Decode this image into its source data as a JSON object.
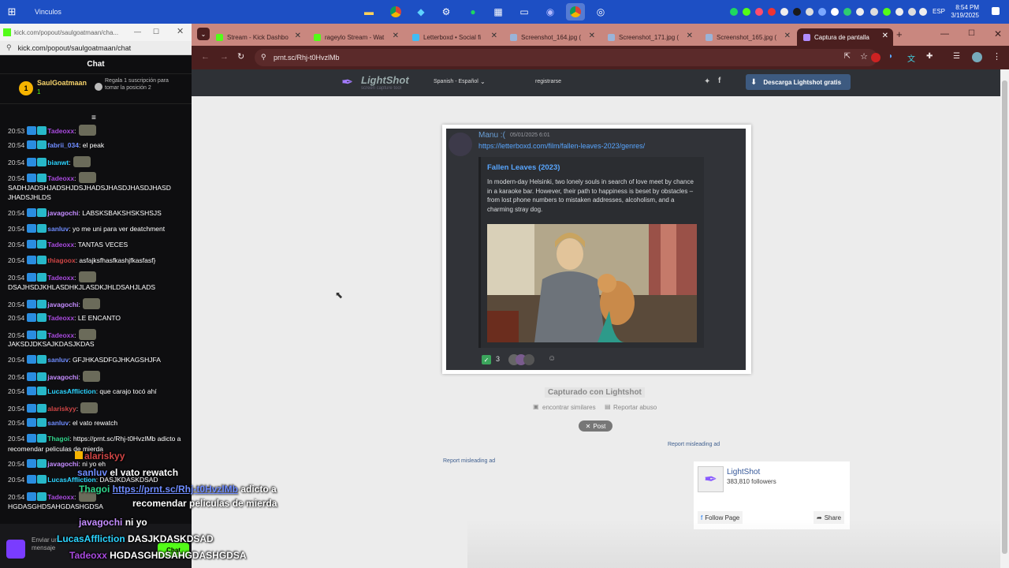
{
  "taskbar": {
    "folder": "Vinculos",
    "lang": "ESP",
    "time": "8:54 PM",
    "date": "3/19/2025"
  },
  "popout": {
    "title_url": "kick.com/popout/saulgoatmaan/cha...",
    "url": "kick.com/popout/saulgoatmaan/chat",
    "chat_header": "Chat",
    "gifter_name": "SaulGoatmaan",
    "gifter_count": "1",
    "gift_text": "Regala 1 suscripción para tomar la posición 2",
    "gift_position": "2",
    "messages": [
      {
        "time": "20:53",
        "user": "Tadeoxx",
        "color": "#a94adf",
        "text": ":"
      },
      {
        "time": "20:54",
        "user": "fabrii_034",
        "color": "#6f8cff",
        "text": ": el peak"
      },
      {
        "time": "20:54",
        "user": "bianwt",
        "color": "#2bd4ff",
        "text": ":"
      },
      {
        "time": "20:54",
        "user": "Tadeoxx",
        "color": "#a94adf",
        "text": ":"
      },
      {
        "time": "",
        "user": "",
        "color": "#ffffff",
        "text": "SADHJADSHJADSHJDSJHADSJHASDJHASDJHASD"
      },
      {
        "time": "",
        "user": "",
        "color": "#ffffff",
        "text": "JHADSJHLDS"
      },
      {
        "time": "20:54",
        "user": "javagochi",
        "color": "#c48cff",
        "text": ": LABSKSBAKSHSKSHSJS"
      },
      {
        "time": "20:54",
        "user": "sanluv",
        "color": "#6f8cff",
        "text": ": yo me uni para ver deatchment"
      },
      {
        "time": "20:54",
        "user": "Tadeoxx",
        "color": "#a94adf",
        "text": ": TANTAS VECES"
      },
      {
        "time": "20:54",
        "user": "thiagoox",
        "color": "#d04545",
        "text": ": asfajksfhasfkashjfkasfasf}"
      },
      {
        "time": "20:54",
        "user": "Tadeoxx",
        "color": "#a94adf",
        "text": ":"
      },
      {
        "time": "",
        "user": "",
        "color": "#ffffff",
        "text": "DSAJHSDJKHLASDHKJLASDKJHLDSAHJLADS"
      },
      {
        "time": "20:54",
        "user": "javagochi",
        "color": "#c48cff",
        "text": ":"
      },
      {
        "time": "20:54",
        "user": "Tadeoxx",
        "color": "#a94adf",
        "text": ": LE ENCANTO"
      },
      {
        "time": "20:54",
        "user": "Tadeoxx",
        "color": "#a94adf",
        "text": ":"
      },
      {
        "time": "",
        "user": "",
        "color": "#ffffff",
        "text": "JAKSDJDKSAJKDASJKDAS"
      },
      {
        "time": "20:54",
        "user": "sanluv",
        "color": "#6f8cff",
        "text": ": GFJHKASDFGJHKAGSHJFA"
      },
      {
        "time": "20:54",
        "user": "javagochi",
        "color": "#c48cff",
        "text": ":"
      },
      {
        "time": "20:54",
        "user": "LucasAffliction",
        "color": "#2bd4ff",
        "text": ": que carajo tocó ahí"
      },
      {
        "time": "20:54",
        "user": "alariskyy",
        "color": "#d04545",
        "text": ":"
      },
      {
        "time": "20:54",
        "user": "sanluv",
        "color": "#6f8cff",
        "text": ": el vato rewatch"
      },
      {
        "time": "20:54",
        "user": "Thagoi",
        "color": "#2fd48a",
        "text": ": https://prnt.sc/Rhj-t0HvzlMb adicto a recomendar peliculas de mierda"
      },
      {
        "time": "20:54",
        "user": "javagochi",
        "color": "#c48cff",
        "text": ": ni yo eh"
      },
      {
        "time": "20:54",
        "user": "LucasAffliction",
        "color": "#2bd4ff",
        "text": ": DASJKDASKDSAD"
      },
      {
        "time": "20:54",
        "user": "Tadeoxx",
        "color": "#a94adf",
        "text": ":"
      },
      {
        "time": "",
        "user": "",
        "color": "#ffffff",
        "text": "HGDASGHDSAHGDASHGDSA"
      }
    ],
    "input_placeholder": "Enviar un mensaje",
    "chat_button": "Chat"
  },
  "overlay": {
    "l1_user": "alariskyy",
    "l2_user": "sanluv",
    "l2_text": "el vato rewatch",
    "l3_user": "Thagoi",
    "l3_link": "https://prnt.sc/Rhj-t0HvzlMb",
    "l3_text": "adicto a",
    "l3b_text": "recomendar peliculas de mierda",
    "l4_user": "javagochi",
    "l4_text": "ni yo",
    "l5_user": "LucasAffliction",
    "l5_text": "DASJKDASKDSAD",
    "l6_user": "Tadeoxx",
    "l6_text": "HGDASGHDSAHGDASHGDSA"
  },
  "browser": {
    "tabs": [
      {
        "label": "Stream - Kick Dashbo",
        "icon_color": "#53fc18"
      },
      {
        "label": "rageylo Stream - Wat",
        "icon_color": "#53fc18"
      },
      {
        "label": "Letterboxd • Social fi",
        "icon_color": "#40bcf4"
      },
      {
        "label": "Screenshot_164.jpg (",
        "icon_color": "#9ab3d8"
      },
      {
        "label": "Screenshot_171.jpg (",
        "icon_color": "#9ab3d8"
      },
      {
        "label": "Screenshot_165.jpg (",
        "icon_color": "#9ab3d8"
      },
      {
        "label": "Captura de pantalla",
        "icon_color": "#b18cff"
      }
    ],
    "url": "prnt.sc/Rhj-t0HvzlMb"
  },
  "lightshot": {
    "logo": "LightShot",
    "logo_sub": "screen capture tool",
    "language": "Spanish - Español",
    "register": "registrarse",
    "download": "Descarga Lightshot gratis",
    "captured_with": "Capturado con Lightshot",
    "find_similar": "encontrar similares",
    "report_abuse": "Reportar abuso",
    "post": "Post",
    "report_ad_1": "Report misleading ad",
    "report_ad_2": "Report misleading ad",
    "fb_name": "LightShot",
    "fb_followers": "383,810 followers",
    "fb_follow": "Follow Page",
    "fb_share": "Share"
  },
  "discord": {
    "username": "Manu :(",
    "timestamp": "05/01/2025 6:01",
    "link": "https://letterboxd.com/film/fallen-leaves-2023/genres/",
    "embed_title": "Fallen Leaves (2023)",
    "embed_desc": "In modern-day Helsinki, two lonely souls in search of love meet by chance in a karaoke bar. However, their path to happiness is beset by obstacles – from lost phone numbers to mistaken addresses, alcoholism, and a charming stray dog.",
    "reaction_count": "3"
  }
}
